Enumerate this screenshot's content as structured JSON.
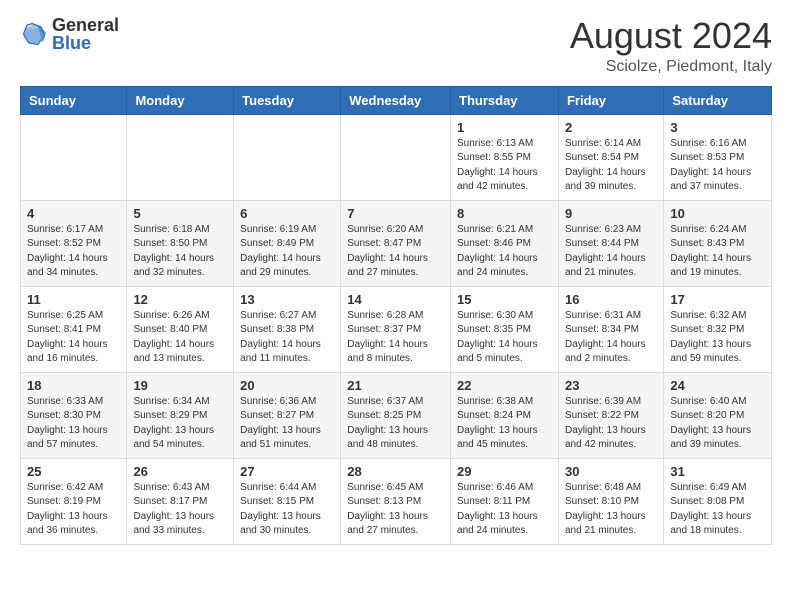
{
  "header": {
    "logo_general": "General",
    "logo_blue": "Blue",
    "month_year": "August 2024",
    "location": "Sciolze, Piedmont, Italy"
  },
  "days_of_week": [
    "Sunday",
    "Monday",
    "Tuesday",
    "Wednesday",
    "Thursday",
    "Friday",
    "Saturday"
  ],
  "weeks": [
    {
      "days": [
        {
          "number": "",
          "info": ""
        },
        {
          "number": "",
          "info": ""
        },
        {
          "number": "",
          "info": ""
        },
        {
          "number": "",
          "info": ""
        },
        {
          "number": "1",
          "info": "Sunrise: 6:13 AM\nSunset: 8:55 PM\nDaylight: 14 hours\nand 42 minutes."
        },
        {
          "number": "2",
          "info": "Sunrise: 6:14 AM\nSunset: 8:54 PM\nDaylight: 14 hours\nand 39 minutes."
        },
        {
          "number": "3",
          "info": "Sunrise: 6:16 AM\nSunset: 8:53 PM\nDaylight: 14 hours\nand 37 minutes."
        }
      ]
    },
    {
      "days": [
        {
          "number": "4",
          "info": "Sunrise: 6:17 AM\nSunset: 8:52 PM\nDaylight: 14 hours\nand 34 minutes."
        },
        {
          "number": "5",
          "info": "Sunrise: 6:18 AM\nSunset: 8:50 PM\nDaylight: 14 hours\nand 32 minutes."
        },
        {
          "number": "6",
          "info": "Sunrise: 6:19 AM\nSunset: 8:49 PM\nDaylight: 14 hours\nand 29 minutes."
        },
        {
          "number": "7",
          "info": "Sunrise: 6:20 AM\nSunset: 8:47 PM\nDaylight: 14 hours\nand 27 minutes."
        },
        {
          "number": "8",
          "info": "Sunrise: 6:21 AM\nSunset: 8:46 PM\nDaylight: 14 hours\nand 24 minutes."
        },
        {
          "number": "9",
          "info": "Sunrise: 6:23 AM\nSunset: 8:44 PM\nDaylight: 14 hours\nand 21 minutes."
        },
        {
          "number": "10",
          "info": "Sunrise: 6:24 AM\nSunset: 8:43 PM\nDaylight: 14 hours\nand 19 minutes."
        }
      ]
    },
    {
      "days": [
        {
          "number": "11",
          "info": "Sunrise: 6:25 AM\nSunset: 8:41 PM\nDaylight: 14 hours\nand 16 minutes."
        },
        {
          "number": "12",
          "info": "Sunrise: 6:26 AM\nSunset: 8:40 PM\nDaylight: 14 hours\nand 13 minutes."
        },
        {
          "number": "13",
          "info": "Sunrise: 6:27 AM\nSunset: 8:38 PM\nDaylight: 14 hours\nand 11 minutes."
        },
        {
          "number": "14",
          "info": "Sunrise: 6:28 AM\nSunset: 8:37 PM\nDaylight: 14 hours\nand 8 minutes."
        },
        {
          "number": "15",
          "info": "Sunrise: 6:30 AM\nSunset: 8:35 PM\nDaylight: 14 hours\nand 5 minutes."
        },
        {
          "number": "16",
          "info": "Sunrise: 6:31 AM\nSunset: 8:34 PM\nDaylight: 14 hours\nand 2 minutes."
        },
        {
          "number": "17",
          "info": "Sunrise: 6:32 AM\nSunset: 8:32 PM\nDaylight: 13 hours\nand 59 minutes."
        }
      ]
    },
    {
      "days": [
        {
          "number": "18",
          "info": "Sunrise: 6:33 AM\nSunset: 8:30 PM\nDaylight: 13 hours\nand 57 minutes."
        },
        {
          "number": "19",
          "info": "Sunrise: 6:34 AM\nSunset: 8:29 PM\nDaylight: 13 hours\nand 54 minutes."
        },
        {
          "number": "20",
          "info": "Sunrise: 6:36 AM\nSunset: 8:27 PM\nDaylight: 13 hours\nand 51 minutes."
        },
        {
          "number": "21",
          "info": "Sunrise: 6:37 AM\nSunset: 8:25 PM\nDaylight: 13 hours\nand 48 minutes."
        },
        {
          "number": "22",
          "info": "Sunrise: 6:38 AM\nSunset: 8:24 PM\nDaylight: 13 hours\nand 45 minutes."
        },
        {
          "number": "23",
          "info": "Sunrise: 6:39 AM\nSunset: 8:22 PM\nDaylight: 13 hours\nand 42 minutes."
        },
        {
          "number": "24",
          "info": "Sunrise: 6:40 AM\nSunset: 8:20 PM\nDaylight: 13 hours\nand 39 minutes."
        }
      ]
    },
    {
      "days": [
        {
          "number": "25",
          "info": "Sunrise: 6:42 AM\nSunset: 8:19 PM\nDaylight: 13 hours\nand 36 minutes."
        },
        {
          "number": "26",
          "info": "Sunrise: 6:43 AM\nSunset: 8:17 PM\nDaylight: 13 hours\nand 33 minutes."
        },
        {
          "number": "27",
          "info": "Sunrise: 6:44 AM\nSunset: 8:15 PM\nDaylight: 13 hours\nand 30 minutes."
        },
        {
          "number": "28",
          "info": "Sunrise: 6:45 AM\nSunset: 8:13 PM\nDaylight: 13 hours\nand 27 minutes."
        },
        {
          "number": "29",
          "info": "Sunrise: 6:46 AM\nSunset: 8:11 PM\nDaylight: 13 hours\nand 24 minutes."
        },
        {
          "number": "30",
          "info": "Sunrise: 6:48 AM\nSunset: 8:10 PM\nDaylight: 13 hours\nand 21 minutes."
        },
        {
          "number": "31",
          "info": "Sunrise: 6:49 AM\nSunset: 8:08 PM\nDaylight: 13 hours\nand 18 minutes."
        }
      ]
    }
  ]
}
